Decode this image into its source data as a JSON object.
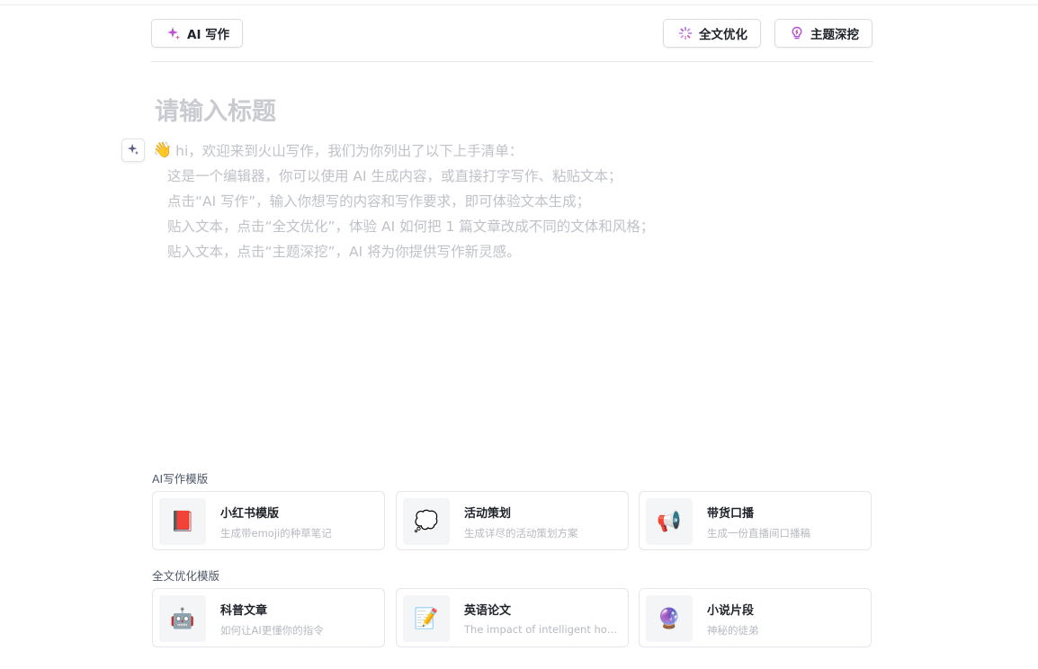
{
  "toolbar": {
    "ai_write_label": "AI 写作",
    "optimize_label": "全文优化",
    "topic_label": "主题深挖"
  },
  "editor": {
    "title_placeholder": "请输入标题",
    "intro_emoji": "👋",
    "intro": "hi，欢迎来到火山写作，我们为你列出了以下上手清单：",
    "lines": [
      "这是一个编辑器，你可以使用 AI 生成内容，或直接打字写作、粘贴文本；",
      "点击“AI 写作”，输入你想写的内容和写作要求，即可体验文本生成；",
      "贴入文本，点击“全文优化”，体验 AI 如何把 1 篇文章改成不同的文体和风格；",
      "贴入文本，点击“主题深挖”，AI 将为你提供写作新灵感。"
    ]
  },
  "ai_templates": {
    "label": "AI写作模版",
    "items": [
      {
        "icon": "📕",
        "icon_name": "red-book-icon",
        "title": "小红书模版",
        "desc": "生成带emoji的种草笔记"
      },
      {
        "icon": "💭",
        "icon_name": "thought-bubble-icon",
        "title": "活动策划",
        "desc": "生成详尽的活动策划方案"
      },
      {
        "icon": "📢",
        "icon_name": "megaphone-icon",
        "title": "带货口播",
        "desc": "生成一份直播间口播稿"
      }
    ]
  },
  "opt_templates": {
    "label": "全文优化模版",
    "items": [
      {
        "icon": "🤖",
        "icon_name": "robot-icon",
        "title": "科普文章",
        "desc": "如何让AI更懂你的指令"
      },
      {
        "icon": "📝",
        "icon_name": "memo-icon",
        "title": "英语论文",
        "desc": "The impact of intelligent housing on modern life"
      },
      {
        "icon": "🔮",
        "icon_name": "crystal-ball-icon",
        "title": "小说片段",
        "desc": "神秘的徒弟"
      }
    ]
  },
  "colors": {
    "accent_purple": "#9b4dd6",
    "accent_pink": "#d946a8",
    "placeholder": "#c9cbd1",
    "muted_text": "#bfc2c9"
  }
}
